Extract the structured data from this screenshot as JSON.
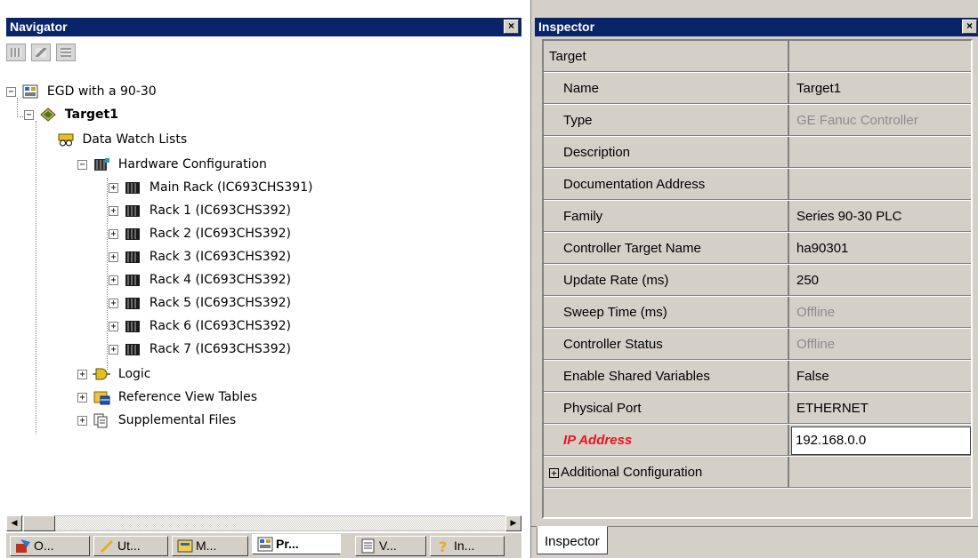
{
  "navigator": {
    "title": "Navigator",
    "close_glyph": "×",
    "toolbar": [
      "list-view-icon",
      "edit-view-icon",
      "grid-view-icon"
    ],
    "tree": [
      {
        "label": "EGD with a 90-30",
        "icon": "project-icon",
        "expander": "−"
      },
      {
        "label": "Target1",
        "icon": "target-icon",
        "expander": "−",
        "bold": true
      },
      {
        "label": "Data Watch Lists",
        "icon": "data-watch-icon"
      },
      {
        "label": "Hardware Configuration",
        "icon": "hardware-icon",
        "expander": "−"
      },
      {
        "label": "Main Rack (IC693CHS391)",
        "icon": "rack-icon",
        "expander": "+"
      },
      {
        "label": "Rack 1 (IC693CHS392)",
        "icon": "rack-icon",
        "expander": "+"
      },
      {
        "label": "Rack 2 (IC693CHS392)",
        "icon": "rack-icon",
        "expander": "+"
      },
      {
        "label": "Rack 3 (IC693CHS392)",
        "icon": "rack-icon",
        "expander": "+"
      },
      {
        "label": "Rack 4 (IC693CHS392)",
        "icon": "rack-icon",
        "expander": "+"
      },
      {
        "label": "Rack 5 (IC693CHS392)",
        "icon": "rack-icon",
        "expander": "+"
      },
      {
        "label": "Rack 6 (IC693CHS392)",
        "icon": "rack-icon",
        "expander": "+"
      },
      {
        "label": "Rack 7 (IC693CHS392)",
        "icon": "rack-icon",
        "expander": "+"
      },
      {
        "label": "Logic",
        "icon": "logic-icon",
        "expander": "+"
      },
      {
        "label": "Reference View Tables",
        "icon": "reference-tables-icon",
        "expander": "+"
      },
      {
        "label": "Supplemental Files",
        "icon": "supplemental-files-icon",
        "expander": "+"
      }
    ],
    "scroll_left": "◀",
    "scroll_right": "▶",
    "tabs": [
      {
        "label": "O...",
        "icon": "options-icon"
      },
      {
        "label": "Ut...",
        "icon": "utilities-icon"
      },
      {
        "label": "M...",
        "icon": "manager-icon"
      },
      {
        "label": "Pr...",
        "icon": "project-icon",
        "active": true
      },
      {
        "label": "V...",
        "icon": "variables-icon"
      },
      {
        "label": "In...",
        "icon": "help-icon"
      }
    ]
  },
  "inspector": {
    "title": "Inspector",
    "close_glyph": "×",
    "rows": [
      {
        "name": "Target",
        "value": "",
        "top": true
      },
      {
        "name": "Name",
        "value": "Target1"
      },
      {
        "name": "Type",
        "value": "GE Fanuc Controller",
        "muted": true
      },
      {
        "name": "Description",
        "value": ""
      },
      {
        "name": "Documentation Address",
        "value": ""
      },
      {
        "name": "Family",
        "value": "Series 90-30 PLC"
      },
      {
        "name": "Controller Target Name",
        "value": "ha90301"
      },
      {
        "name": "Update Rate (ms)",
        "value": "250"
      },
      {
        "name": "Sweep Time (ms)",
        "value": "Offline",
        "muted": true
      },
      {
        "name": "Controller Status",
        "value": "Offline",
        "muted": true
      },
      {
        "name": "Enable Shared Variables",
        "value": "False"
      },
      {
        "name": "Physical Port",
        "value": "ETHERNET"
      },
      {
        "name": "IP Address",
        "value": "192.168.0.0",
        "editing": true
      },
      {
        "name": "Additional Configuration",
        "value": "",
        "expander": "+",
        "top": true
      }
    ],
    "tab_label": "Inspector"
  },
  "colors": {
    "title_bar": "#0a246a",
    "highlight_label": "#e8141e",
    "muted_text": "#8c8c8c",
    "panel_bg": "#d4d0c8"
  }
}
